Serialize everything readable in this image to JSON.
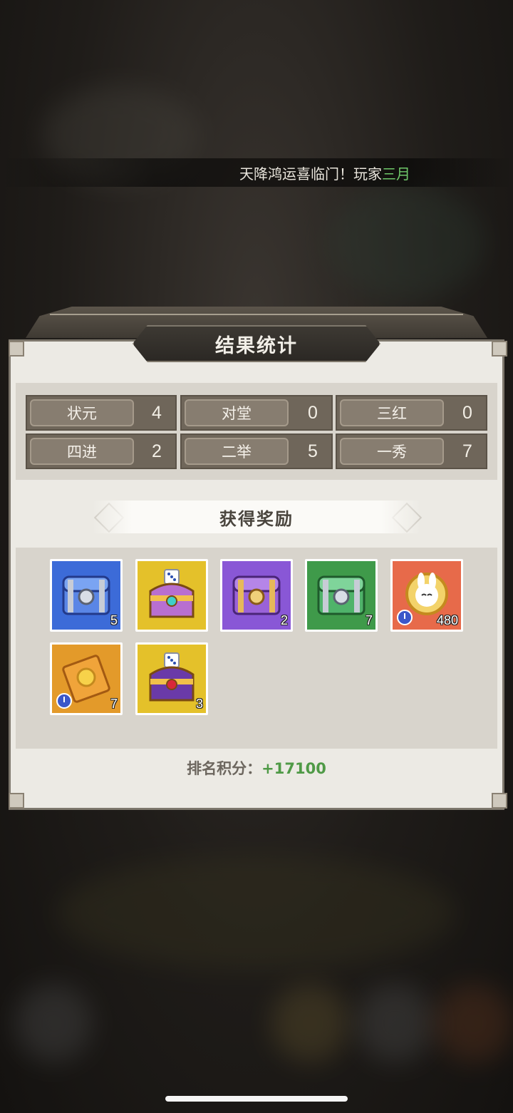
{
  "ticker": {
    "prefix": "天降鸿运喜临门！玩家",
    "name": "三月"
  },
  "panel": {
    "title": "结果统计"
  },
  "stats": [
    {
      "label": "状元",
      "value": "4"
    },
    {
      "label": "对堂",
      "value": "0"
    },
    {
      "label": "三红",
      "value": "0"
    },
    {
      "label": "四进",
      "value": "2"
    },
    {
      "label": "二举",
      "value": "5"
    },
    {
      "label": "一秀",
      "value": "7"
    }
  ],
  "rewards": {
    "title": "获得奖励",
    "items": [
      {
        "icon": "blue-treasure-chest",
        "count": "5",
        "bg": "#3c6bd8"
      },
      {
        "icon": "gold-dice-chest",
        "count": "",
        "bg": "#e4c12a"
      },
      {
        "icon": "purple-treasure-chest",
        "count": "2",
        "bg": "#8957d6"
      },
      {
        "icon": "green-treasure-chest",
        "count": "7",
        "bg": "#3f9a4a"
      },
      {
        "icon": "rabbit-coin-timed",
        "count": "480",
        "bg": "#e76a4a"
      },
      {
        "icon": "gold-card-timed",
        "count": "7",
        "bg": "#e39a2a"
      },
      {
        "icon": "purple-dice-chest",
        "count": "3",
        "bg": "#e4c12a"
      }
    ]
  },
  "rank": {
    "label": "排名积分：",
    "value": "+17100"
  }
}
